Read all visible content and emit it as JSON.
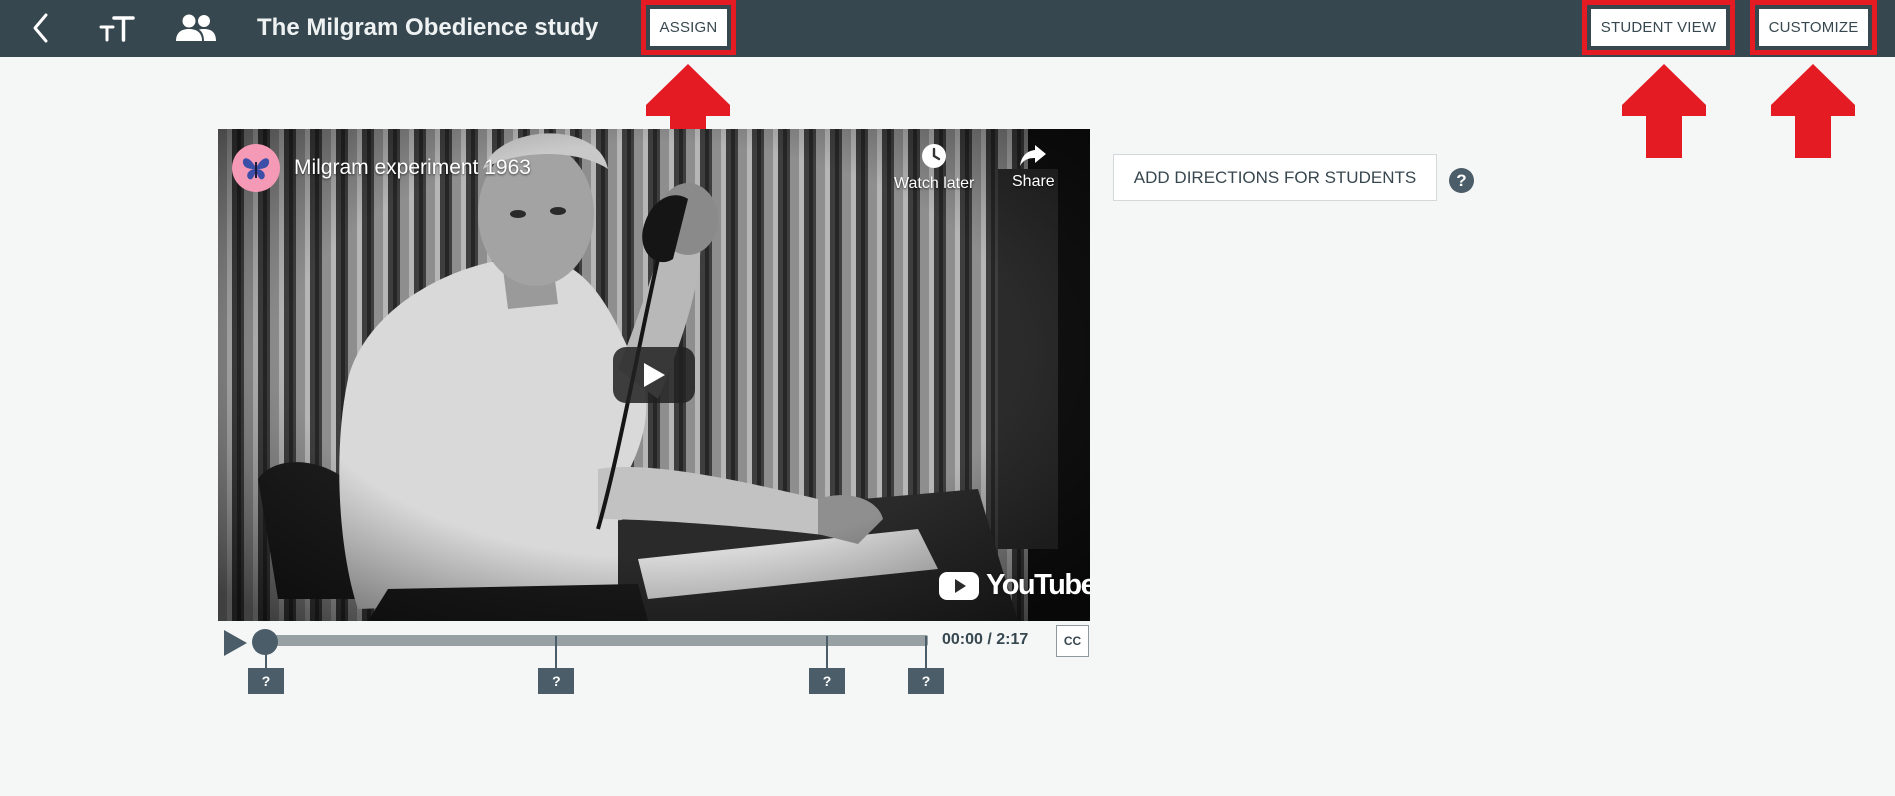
{
  "header": {
    "title": "The Milgram Obedience study",
    "assign_label": "ASSIGN",
    "student_view_label": "STUDENT VIEW",
    "customize_label": "CUSTOMIZE",
    "icons": [
      "back-chevron-icon",
      "text-size-icon",
      "people-icon"
    ],
    "bg_color": "#37474f",
    "highlight_color": "#e41b23"
  },
  "video": {
    "title": "Milgram experiment 1963",
    "watch_later_label": "Watch later",
    "share_label": "Share",
    "brand": "YouTube"
  },
  "player": {
    "time": "00:00 / 2:17",
    "progress": 0,
    "cc_label": "CC",
    "question_markers": [
      {
        "label": "?",
        "position": 0.0
      },
      {
        "label": "?",
        "position": 0.44
      },
      {
        "label": "?",
        "position": 0.85
      },
      {
        "label": "?",
        "position": 1.0
      }
    ]
  },
  "directions": {
    "label": "ADD DIRECTIONS FOR STUDENTS",
    "help_label": "?"
  }
}
